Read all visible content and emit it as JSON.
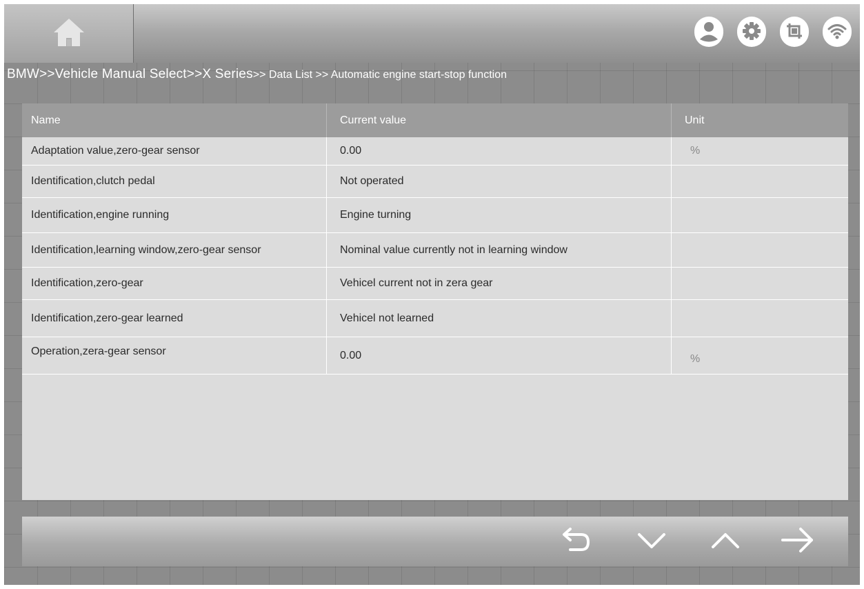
{
  "header": {
    "icons": [
      "home-icon",
      "user-icon",
      "settings-icon",
      "screenshot-icon",
      "wifi-icon"
    ]
  },
  "breadcrumb": {
    "main": "BMW>>Vehicle Manual Select>>X Series",
    "tail": ">> Data List >> Automatic engine start-stop function"
  },
  "table": {
    "headers": [
      "Name",
      "Current value",
      "Unit"
    ],
    "rows": [
      {
        "name": "Adaptation value,zero-gear sensor",
        "value": "0.00",
        "unit": "%"
      },
      {
        "name": "Identification,clutch pedal",
        "value": "Not operated",
        "unit": ""
      },
      {
        "name": "Identification,engine running",
        "value": "Engine turning",
        "unit": ""
      },
      {
        "name": "Identification,learning window,zero-gear sensor",
        "value": "Nominal value currently not in learning window",
        "unit": ""
      },
      {
        "name": "Identification,zero-gear",
        "value": "Vehicel current not in zera gear",
        "unit": ""
      },
      {
        "name": "Identification,zero-gear learned",
        "value": "Vehicel not learned",
        "unit": ""
      },
      {
        "name": "Operation,zera-gear sensor",
        "value": "0.00",
        "unit": "%"
      }
    ]
  },
  "footer": {
    "buttons": [
      "back-icon",
      "page-down-icon",
      "page-up-icon",
      "next-icon"
    ]
  },
  "colors": {
    "background": "#8c8c8c",
    "header_row": "#9c9c9c",
    "table_body": "#dcdcdc",
    "icon": "#ffffff"
  }
}
